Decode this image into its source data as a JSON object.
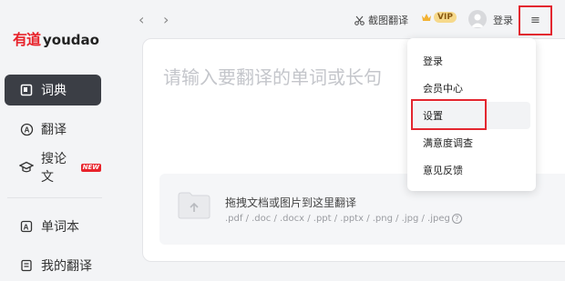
{
  "brand": {
    "name_cn": "有道",
    "name_en": "youdao",
    "color": "#e8232b"
  },
  "sidebar": {
    "items": [
      {
        "label": "词典",
        "icon": "book-icon",
        "active": true
      },
      {
        "label": "翻译",
        "icon": "translate-icon"
      },
      {
        "label": "搜论文",
        "icon": "graduation-cap-icon",
        "badge": "NEW"
      },
      {
        "label": "单词本",
        "icon": "wordbook-icon"
      },
      {
        "label": "我的翻译",
        "icon": "document-icon"
      }
    ]
  },
  "topbar": {
    "back_icon": "‹",
    "forward_icon": "›",
    "screenshot_translate": "截图翻译",
    "vip_label": "VIP",
    "login_label": "登录",
    "menu_icon": "≡"
  },
  "input": {
    "placeholder": "请输入要翻译的单词或长句"
  },
  "upload": {
    "title": "拖拽文档或图片到这里翻译",
    "formats": ".pdf / .doc / .docx / .ppt / .pptx / .png / .jpg / .jpeg"
  },
  "dropdown": {
    "items": [
      {
        "label": "登录"
      },
      {
        "label": "会员中心"
      },
      {
        "label": "设置",
        "hovered": true
      },
      {
        "label": "满意度调查"
      },
      {
        "label": "意见反馈"
      }
    ]
  },
  "colors": {
    "highlight": "#e3262f",
    "active_nav_bg": "#3b3e45"
  }
}
